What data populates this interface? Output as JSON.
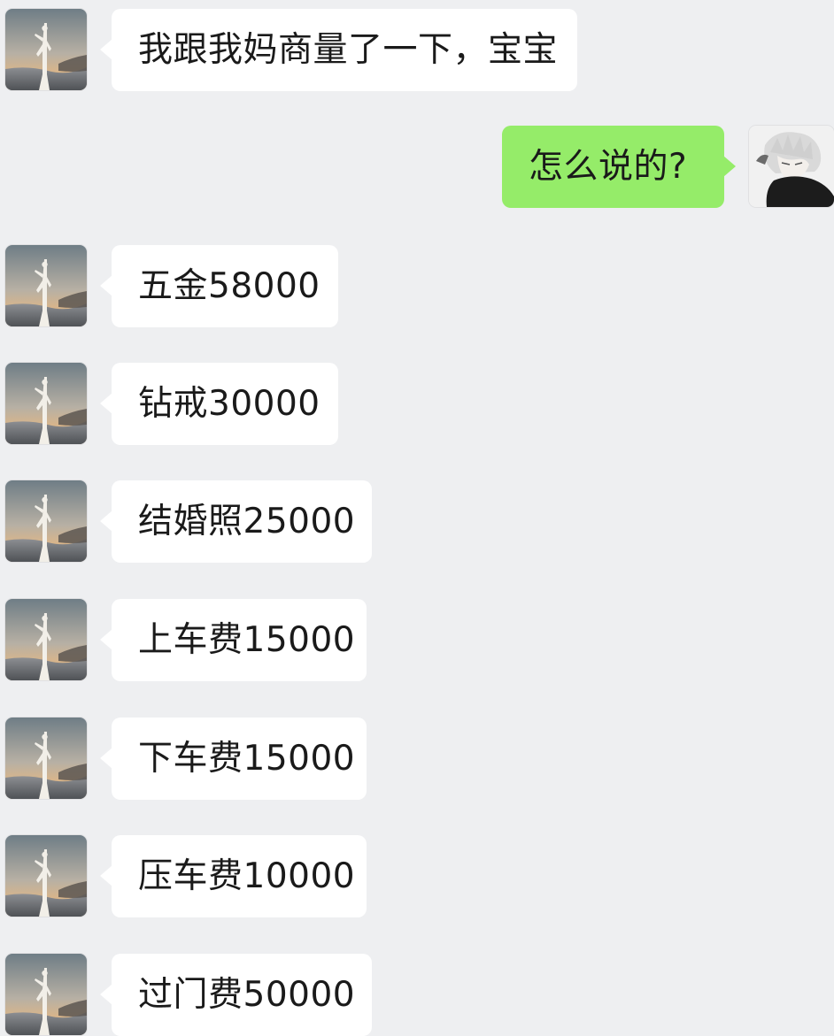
{
  "chat": {
    "messages": [
      {
        "side": "left",
        "text": "我跟我妈商量了一下，宝宝",
        "avatar_icon": "sunset-statue-avatar-icon"
      },
      {
        "side": "right",
        "text": "怎么说的?",
        "avatar_icon": "anime-boy-avatar-icon"
      },
      {
        "side": "left",
        "text": "五金58000",
        "avatar_icon": "sunset-statue-avatar-icon"
      },
      {
        "side": "left",
        "text": "钻戒30000",
        "avatar_icon": "sunset-statue-avatar-icon"
      },
      {
        "side": "left",
        "text": "结婚照25000",
        "avatar_icon": "sunset-statue-avatar-icon"
      },
      {
        "side": "left",
        "text": "上车费15000",
        "avatar_icon": "sunset-statue-avatar-icon"
      },
      {
        "side": "left",
        "text": "下车费15000",
        "avatar_icon": "sunset-statue-avatar-icon"
      },
      {
        "side": "left",
        "text": "压车费10000",
        "avatar_icon": "sunset-statue-avatar-icon"
      },
      {
        "side": "left",
        "text": "过门费50000",
        "avatar_icon": "sunset-statue-avatar-icon"
      }
    ]
  },
  "colors": {
    "background": "#eeeff1",
    "incoming_bubble": "#ffffff",
    "outgoing_bubble": "#95ec69",
    "text": "#1a1a1a"
  }
}
